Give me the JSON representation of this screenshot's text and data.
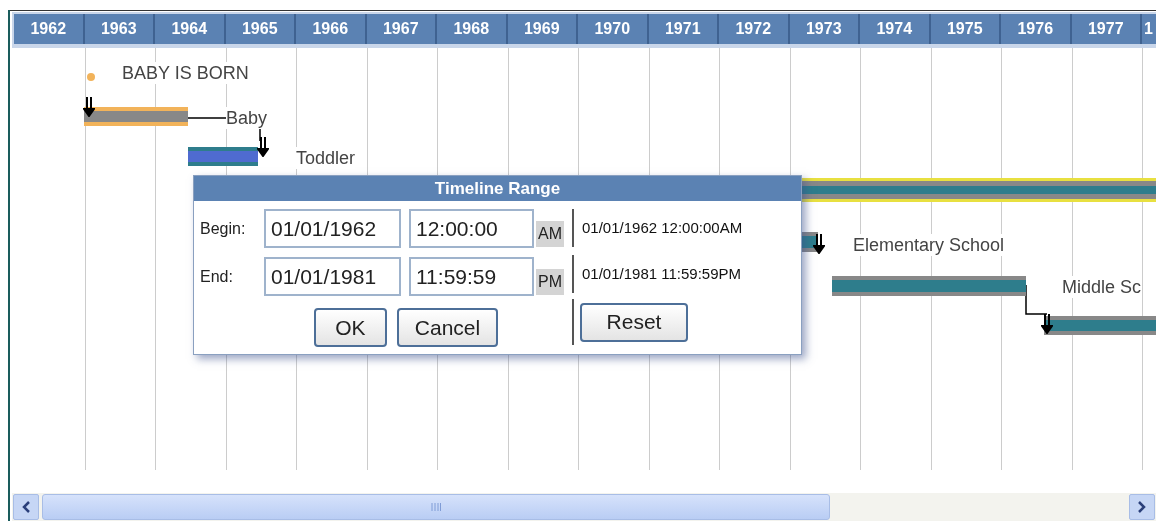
{
  "timeline": {
    "years": [
      "1962",
      "1963",
      "1964",
      "1965",
      "1966",
      "1967",
      "1968",
      "1969",
      "1970",
      "1971",
      "1972",
      "1973",
      "1974",
      "1975",
      "1976",
      "1977",
      "1"
    ],
    "tasks": [
      {
        "kind": "milestone",
        "label": "BABY IS BORN"
      },
      {
        "kind": "bar",
        "label": "Baby"
      },
      {
        "kind": "bar",
        "label": "Toddler"
      },
      {
        "kind": "bar"
      },
      {
        "kind": "bar",
        "label": "Elementary School"
      },
      {
        "kind": "bar",
        "label": "Middle Sc"
      },
      {
        "kind": "bar"
      }
    ]
  },
  "dialog": {
    "title": "Timeline Range",
    "rows": [
      {
        "label": "Begin:",
        "date": "01/01/1962",
        "time": "12:00:00",
        "ampm": "AM",
        "summary": "01/01/1962 12:00:00AM"
      },
      {
        "label": "End:",
        "date": "01/01/1981",
        "time": "11:59:59",
        "ampm": "PM",
        "summary": "01/01/1981 11:59:59PM"
      }
    ],
    "buttons": [
      "OK",
      "Cancel"
    ],
    "reset": "Reset"
  }
}
